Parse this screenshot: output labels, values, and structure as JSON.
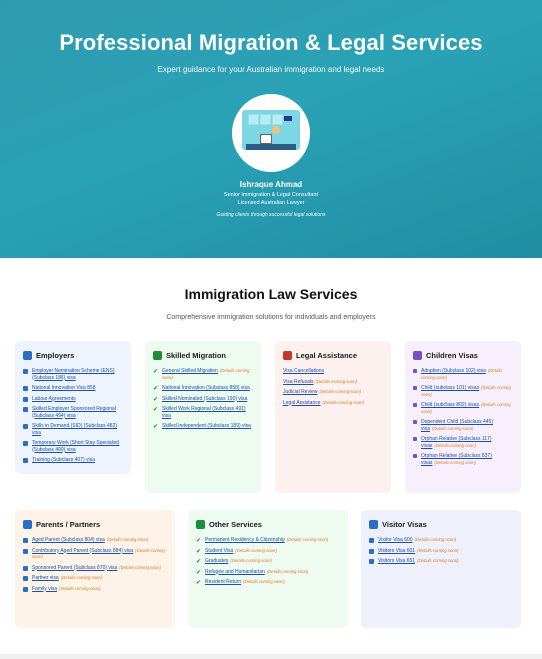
{
  "hero": {
    "title": "Professional Migration & Legal Services",
    "subtitle": "Expert guidance for your Australian immigration and legal needs",
    "name": "Ishraque Ahmad",
    "role1": "Senior Immigration & Legal Consultant",
    "role2": "Licensed Australian Lawyer",
    "tagline": "Guiding clients through successful legal solutions"
  },
  "services": {
    "title": "Immigration Law Services",
    "description": "Comprehensive immigration solutions for individuals and employers"
  },
  "cards": [
    {
      "title": "Employers",
      "icon": "building-icon",
      "bullet": "square",
      "bg": "#eef4fd",
      "accent": "#2b6fc4",
      "items": [
        {
          "t": "Employer Nomination Scheme (ENS) (Subclass 186) visa"
        },
        {
          "t": "National Innovation Visa 858"
        },
        {
          "t": "Labour Agreements"
        },
        {
          "t": "Skilled Employer Sponsored Regional (Subclass 494) visa"
        },
        {
          "t": "Skills in Demand (SID) (Subclass 482) visa"
        },
        {
          "t": "Temporary Work (Short Stay Specialist) (Subclass 400) visa"
        },
        {
          "t": "Training (Subclass 407) visa"
        }
      ]
    },
    {
      "title": "Skilled Migration",
      "icon": "graduation-cap-icon",
      "bullet": "check",
      "bg": "#eefbf0",
      "accent": "#1d8d3a",
      "items": [
        {
          "t": "General Skilled Migration",
          "c": "(Details coming soon)"
        },
        {
          "t": "National Innovation (Subclass 858) visa"
        },
        {
          "t": "Skilled Nominated (Subclass 190) visa"
        },
        {
          "t": "Skilled Work Regional (Subclass 491) visa"
        },
        {
          "t": "Skilled Independent (Subclass 189) visa"
        }
      ]
    },
    {
      "title": "Legal Assistance",
      "icon": "scales-icon",
      "bullet": "none",
      "bg": "#fdf1f0",
      "accent": "#c0392b",
      "items": [
        {
          "t": "Visa Cancellations"
        },
        {
          "t": "Visa Refusals",
          "c": "(Details coming soon)"
        },
        {
          "t": "Judicial Review",
          "c": "(Details coming soon)"
        },
        {
          "t": "Legal Assistance",
          "c": "(Details coming soon)"
        }
      ]
    },
    {
      "title": "Children Visas",
      "icon": "child-face-icon",
      "bullet": "dot",
      "bg": "#f7f0fc",
      "accent": "#7a4fc4",
      "items": [
        {
          "t": "Adoption (Subclass 102) visa",
          "c": "(Details coming soon)"
        },
        {
          "t": "Child (subclass 101) visas",
          "c": "(Details coming soon)"
        },
        {
          "t": "Child (subclass 802) visas",
          "c": "(Details coming soon)"
        },
        {
          "t": "Dependent Child (Subclass 445) visa",
          "c": "(Details coming soon)"
        },
        {
          "t": "Orphan Relative (Subclass 117) visas",
          "c": "(Details coming soon)"
        },
        {
          "t": "Orphan Relative (Subclass 837) visas",
          "c": "(Details coming soon)"
        }
      ]
    },
    {
      "title": "Parents / Partners",
      "icon": "family-icon",
      "bullet": "square",
      "bg": "#fdf3e8",
      "accent": "#2b6fc4",
      "items": [
        {
          "t": "Aged Parent (Subclass 804) visa",
          "c": "(Details coming soon)"
        },
        {
          "t": "Contributory Aged Parent (Subclass 884) visa",
          "c": "(Details coming soon)"
        },
        {
          "t": "Sponsored Parent (Subclass 870) visa",
          "c": "(Details coming soon)"
        },
        {
          "t": "Partner visa",
          "c": "(Details coming soon)"
        },
        {
          "t": "Family visa",
          "c": "(Details coming soon)"
        }
      ]
    },
    {
      "title": "Other Services",
      "icon": "clipboard-icon",
      "bullet": "check",
      "bg": "#eefbf0",
      "accent": "#1d8d3a",
      "items": [
        {
          "t": "Permanent Residency & Citizenship",
          "c": "(Details coming soon)"
        },
        {
          "t": "Student Visa",
          "c": "(Details coming soon)"
        },
        {
          "t": "Graduates",
          "c": "(Details coming soon)"
        },
        {
          "t": "Refugee and Humanitarian",
          "c": "(Details coming soon)"
        },
        {
          "t": "Resident Return",
          "c": "(Details coming soon)"
        }
      ]
    },
    {
      "title": "Visitor Visas",
      "icon": "airplane-icon",
      "bullet": "square",
      "bg": "#eef0fb",
      "accent": "#2b6fc4",
      "items": [
        {
          "t": "Visitor Visa 600",
          "c": "(Details coming soon)"
        },
        {
          "t": "Visitors Visa 601",
          "c": "(Details coming soon)"
        },
        {
          "t": "Visitors Visa 651",
          "c": "(Details coming soon)"
        }
      ]
    }
  ]
}
